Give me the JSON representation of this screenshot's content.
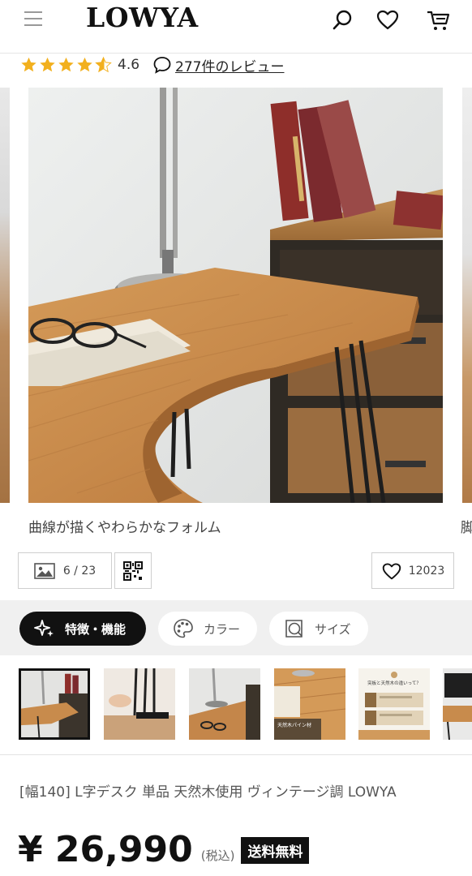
{
  "header": {
    "logo_text": "LOWYA",
    "icons": [
      "menu-icon",
      "search-icon",
      "heart-icon",
      "cart-icon"
    ]
  },
  "rating": {
    "value_text": "4.6",
    "stars": 4.6,
    "review_link": "277件のレビュー"
  },
  "gallery": {
    "caption": "曲線が描くやわらかなフォルム",
    "next_caption_peek": "脚",
    "counter": "6 / 23",
    "favorite_count": "12023"
  },
  "tabs": [
    {
      "label": "特徴・機能",
      "icon": "sparkle-icon",
      "active": true
    },
    {
      "label": "カラー",
      "icon": "palette-icon",
      "active": false
    },
    {
      "label": "サイズ",
      "icon": "size-icon",
      "active": false
    }
  ],
  "thumbnails": [
    {
      "alt": "desk-overview",
      "active": true
    },
    {
      "alt": "leg-assembly",
      "active": false
    },
    {
      "alt": "desk-corner",
      "active": false
    },
    {
      "alt": "desk-top-glasses",
      "active": false
    },
    {
      "alt": "comparison-info",
      "active": false
    },
    {
      "alt": "desk-monitor",
      "active": false
    }
  ],
  "thumb_text": {
    "info_title": "突板と天然木の違いって？",
    "pine_label": "天然木パイン材"
  },
  "product": {
    "title": "[幅140] L字デスク 単品 天然木使用 ヴィンテージ調  LOWYA",
    "price": "¥ 26,990",
    "tax_note": "(税込)",
    "shipping_badge": "送料無料"
  },
  "colors": {
    "star": "#f2b01e",
    "accent_dark": "#111111"
  }
}
